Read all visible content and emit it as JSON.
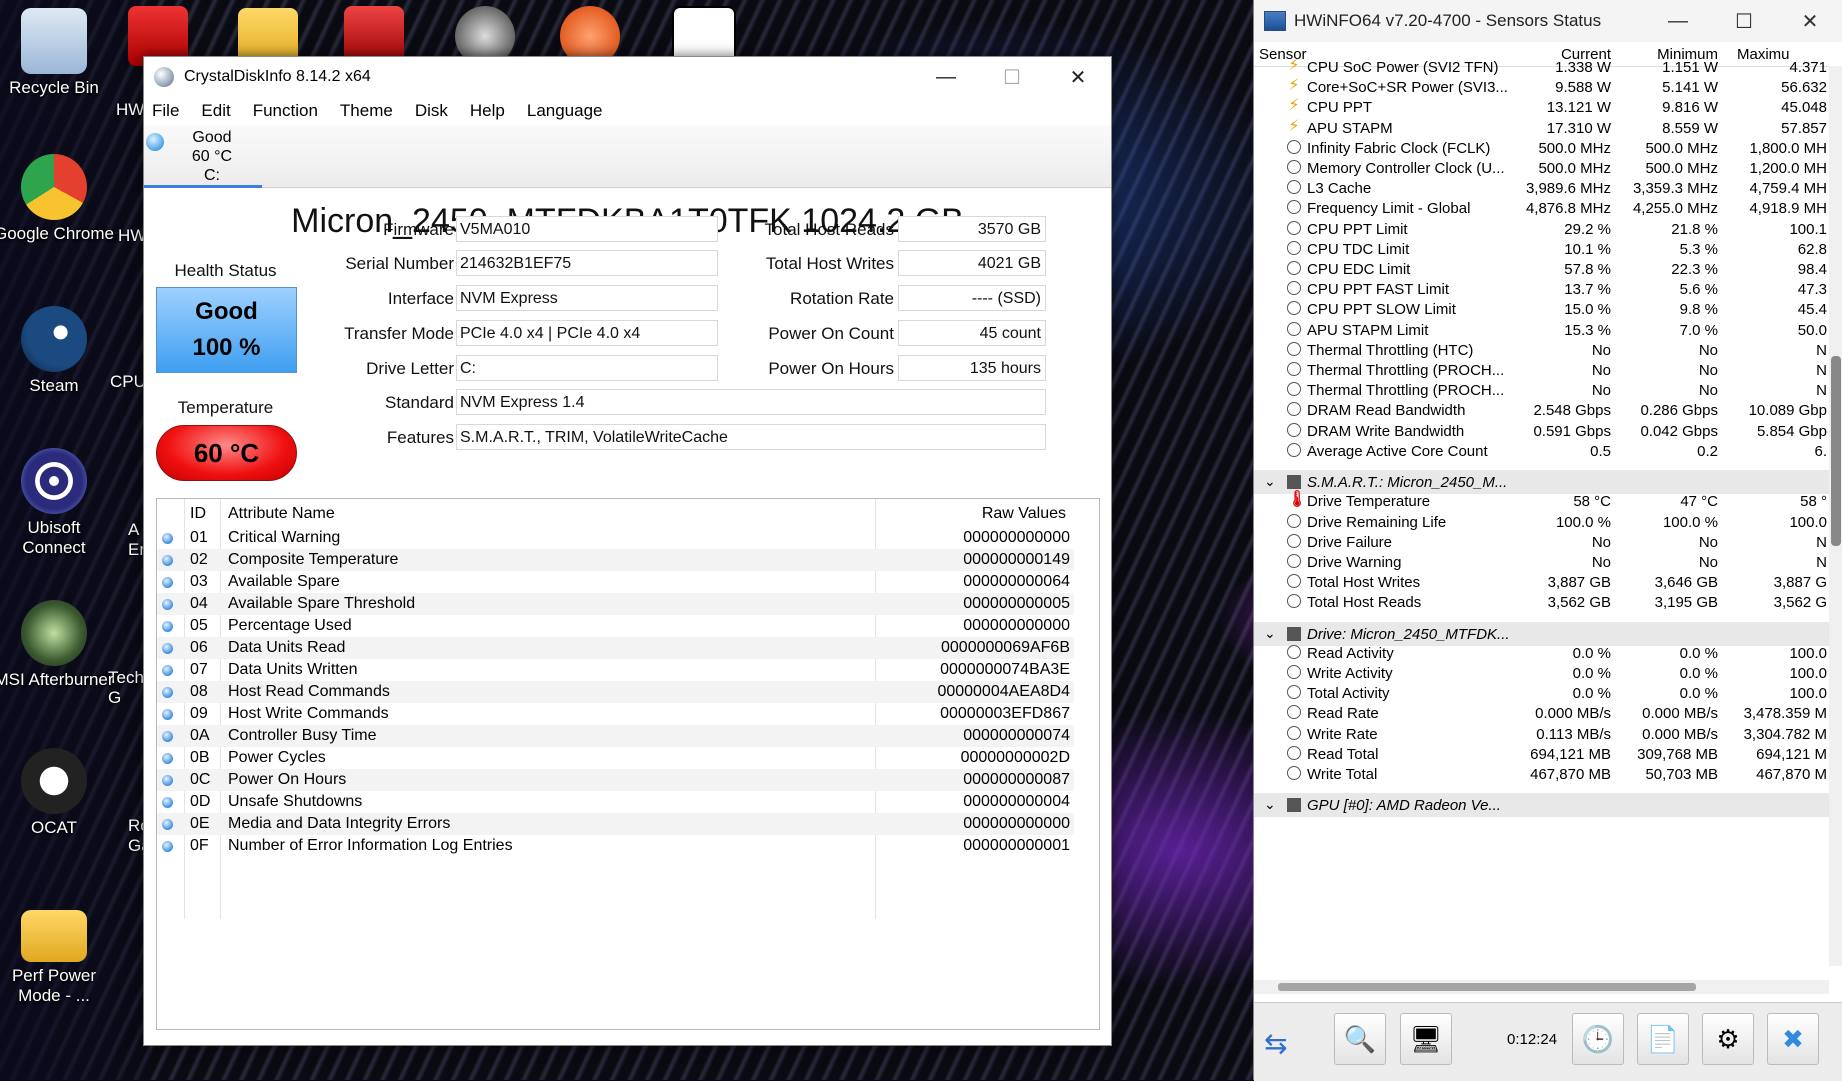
{
  "desktop": {
    "icons": [
      {
        "label": "Recycle Bin",
        "color": "#3d8edb"
      },
      {
        "label": "Google Chrome",
        "color": "#e3402f"
      },
      {
        "label": "Steam",
        "color": "#1b2a48"
      },
      {
        "label": "Ubisoft Connect",
        "color": "#2a3a7a"
      },
      {
        "label": "MSI Afterburner",
        "color": "#5b6b5b"
      },
      {
        "label": "OCAT",
        "color": "#333333"
      },
      {
        "label": "Perf Power Mode - ...",
        "color": "#f2c24d"
      }
    ],
    "partial_labels": [
      "HW",
      "HW",
      "CPU",
      "A Er",
      "Tech G",
      "Ro Ga"
    ]
  },
  "crystaldiskinfo": {
    "title": "CrystalDiskInfo 8.14.2 x64",
    "window_buttons": {
      "minimize": "—",
      "maximize": "☐",
      "close": "✕"
    },
    "menu": [
      "File",
      "Edit",
      "Function",
      "Theme",
      "Disk",
      "Help",
      "Language"
    ],
    "drive_tab": {
      "status": "Good",
      "temp": "60 °C",
      "letter": "C:"
    },
    "model": "Micron_2450_MTFDKBA1T0TFK 1024.2 GB",
    "health_label": "Health Status",
    "health_status": "Good",
    "health_percent": "100 %",
    "temperature_label": "Temperature",
    "temperature": "60 °C",
    "fields_left": {
      "firmware_label": "Firmware",
      "firmware": "V5MA010",
      "serial_label": "Serial Number",
      "serial": "214632B1EF75",
      "interface_label": "Interface",
      "interface": "NVM Express",
      "transfer_label": "Transfer Mode",
      "transfer": "PCIe 4.0 x4 | PCIe 4.0 x4",
      "letter_label": "Drive Letter",
      "letter": "C:",
      "standard_label": "Standard",
      "standard": "NVM Express 1.4",
      "features_label": "Features",
      "features": "S.M.A.R.T., TRIM, VolatileWriteCache"
    },
    "fields_right": {
      "reads_label": "Total Host Reads",
      "reads": "3570 GB",
      "writes_label": "Total Host Writes",
      "writes": "4021 GB",
      "rotation_label": "Rotation Rate",
      "rotation": "---- (SSD)",
      "count_label": "Power On Count",
      "count": "45 count",
      "hours_label": "Power On Hours",
      "hours": "135 hours"
    },
    "attr_headers": {
      "id": "ID",
      "name": "Attribute Name",
      "raw": "Raw Values"
    },
    "attributes": [
      {
        "id": "01",
        "name": "Critical Warning",
        "raw": "000000000000"
      },
      {
        "id": "02",
        "name": "Composite Temperature",
        "raw": "000000000149"
      },
      {
        "id": "03",
        "name": "Available Spare",
        "raw": "000000000064"
      },
      {
        "id": "04",
        "name": "Available Spare Threshold",
        "raw": "000000000005"
      },
      {
        "id": "05",
        "name": "Percentage Used",
        "raw": "000000000000"
      },
      {
        "id": "06",
        "name": "Data Units Read",
        "raw": "0000000069AF6B"
      },
      {
        "id": "07",
        "name": "Data Units Written",
        "raw": "0000000074BA3E"
      },
      {
        "id": "08",
        "name": "Host Read Commands",
        "raw": "00000004AEA8D4"
      },
      {
        "id": "09",
        "name": "Host Write Commands",
        "raw": "00000003EFD867"
      },
      {
        "id": "0A",
        "name": "Controller Busy Time",
        "raw": "000000000074"
      },
      {
        "id": "0B",
        "name": "Power Cycles",
        "raw": "00000000002D"
      },
      {
        "id": "0C",
        "name": "Power On Hours",
        "raw": "000000000087"
      },
      {
        "id": "0D",
        "name": "Unsafe Shutdowns",
        "raw": "000000000004"
      },
      {
        "id": "0E",
        "name": "Media and Data Integrity Errors",
        "raw": "000000000000"
      },
      {
        "id": "0F",
        "name": "Number of Error Information Log Entries",
        "raw": "000000000001"
      }
    ]
  },
  "hwinfo": {
    "title": "HWiNFO64 v7.20-4700 - Sensors Status",
    "window_buttons": {
      "minimize": "—",
      "maximize": "☐",
      "close": "✕"
    },
    "columns": {
      "sensor": "Sensor",
      "current": "Current",
      "minimum": "Minimum",
      "maximum": "Maximu"
    },
    "rows": [
      {
        "icon": "power",
        "name": "CPU SoC Power (SVI2 TFN)",
        "cur": "1.338 W",
        "min": "1.151 W",
        "max": "4.371"
      },
      {
        "icon": "power",
        "name": "Core+SoC+SR Power (SVI3...",
        "cur": "9.588 W",
        "min": "5.141 W",
        "max": "56.632"
      },
      {
        "icon": "power",
        "name": "CPU PPT",
        "cur": "13.121 W",
        "min": "9.816 W",
        "max": "45.048"
      },
      {
        "icon": "power",
        "name": "APU STAPM",
        "cur": "17.310 W",
        "min": "8.559 W",
        "max": "57.857"
      },
      {
        "icon": "clock",
        "name": "Infinity Fabric Clock (FCLK)",
        "cur": "500.0 MHz",
        "min": "500.0 MHz",
        "max": "1,800.0 MH"
      },
      {
        "icon": "clock",
        "name": "Memory Controller Clock (U...",
        "cur": "500.0 MHz",
        "min": "500.0 MHz",
        "max": "1,200.0 MH"
      },
      {
        "icon": "clock",
        "name": "L3 Cache",
        "cur": "3,989.6 MHz",
        "min": "3,359.3 MHz",
        "max": "4,759.4 MH"
      },
      {
        "icon": "clock",
        "name": "Frequency Limit - Global",
        "cur": "4,876.8 MHz",
        "min": "4,255.0 MHz",
        "max": "4,918.9 MH"
      },
      {
        "icon": "clock",
        "name": "CPU PPT Limit",
        "cur": "29.2 %",
        "min": "21.8 %",
        "max": "100.1"
      },
      {
        "icon": "clock",
        "name": "CPU TDC Limit",
        "cur": "10.1 %",
        "min": "5.3 %",
        "max": "62.8"
      },
      {
        "icon": "clock",
        "name": "CPU EDC Limit",
        "cur": "57.8 %",
        "min": "22.3 %",
        "max": "98.4"
      },
      {
        "icon": "clock",
        "name": "CPU PPT FAST Limit",
        "cur": "13.7 %",
        "min": "5.6 %",
        "max": "47.3"
      },
      {
        "icon": "clock",
        "name": "CPU PPT SLOW Limit",
        "cur": "15.0 %",
        "min": "9.8 %",
        "max": "45.4"
      },
      {
        "icon": "clock",
        "name": "APU STAPM Limit",
        "cur": "15.3 %",
        "min": "7.0 %",
        "max": "50.0"
      },
      {
        "icon": "clock",
        "name": "Thermal Throttling (HTC)",
        "cur": "No",
        "min": "No",
        "max": "N"
      },
      {
        "icon": "clock",
        "name": "Thermal Throttling (PROCH...",
        "cur": "No",
        "min": "No",
        "max": "N"
      },
      {
        "icon": "clock",
        "name": "Thermal Throttling (PROCH...",
        "cur": "No",
        "min": "No",
        "max": "N"
      },
      {
        "icon": "clock",
        "name": "DRAM Read Bandwidth",
        "cur": "2.548 Gbps",
        "min": "0.286 Gbps",
        "max": "10.089 Gbp"
      },
      {
        "icon": "clock",
        "name": "DRAM Write Bandwidth",
        "cur": "0.591 Gbps",
        "min": "0.042 Gbps",
        "max": "5.854 Gbp"
      },
      {
        "icon": "clock",
        "name": "Average Active Core Count",
        "cur": "0.5",
        "min": "0.2",
        "max": "6."
      }
    ],
    "group_smart": "S.M.A.R.T.: Micron_2450_M...",
    "smart_rows": [
      {
        "icon": "therm",
        "name": "Drive Temperature",
        "cur": "58 °C",
        "min": "47 °C",
        "max": "58 °"
      },
      {
        "icon": "clock",
        "name": "Drive Remaining Life",
        "cur": "100.0 %",
        "min": "100.0 %",
        "max": "100.0"
      },
      {
        "icon": "clock",
        "name": "Drive Failure",
        "cur": "No",
        "min": "No",
        "max": "N"
      },
      {
        "icon": "clock",
        "name": "Drive Warning",
        "cur": "No",
        "min": "No",
        "max": "N"
      },
      {
        "icon": "clock",
        "name": "Total Host Writes",
        "cur": "3,887 GB",
        "min": "3,646 GB",
        "max": "3,887 G"
      },
      {
        "icon": "clock",
        "name": "Total Host Reads",
        "cur": "3,562 GB",
        "min": "3,195 GB",
        "max": "3,562 G"
      }
    ],
    "group_drive": "Drive: Micron_2450_MTFDK...",
    "drive_rows": [
      {
        "icon": "clock",
        "name": "Read Activity",
        "cur": "0.0 %",
        "min": "0.0 %",
        "max": "100.0"
      },
      {
        "icon": "clock",
        "name": "Write Activity",
        "cur": "0.0 %",
        "min": "0.0 %",
        "max": "100.0"
      },
      {
        "icon": "clock",
        "name": "Total Activity",
        "cur": "0.0 %",
        "min": "0.0 %",
        "max": "100.0"
      },
      {
        "icon": "clock",
        "name": "Read Rate",
        "cur": "0.000 MB/s",
        "min": "0.000 MB/s",
        "max": "3,478.359 M"
      },
      {
        "icon": "clock",
        "name": "Write Rate",
        "cur": "0.113 MB/s",
        "min": "0.000 MB/s",
        "max": "3,304.782 M"
      },
      {
        "icon": "clock",
        "name": "Read Total",
        "cur": "694,121 MB",
        "min": "309,768 MB",
        "max": "694,121 M"
      },
      {
        "icon": "clock",
        "name": "Write Total",
        "cur": "467,870 MB",
        "min": "50,703 MB",
        "max": "467,870 M"
      }
    ],
    "group_gpu": "GPU [#0]: AMD Radeon Ve...",
    "elapsed": "0:12:24"
  }
}
